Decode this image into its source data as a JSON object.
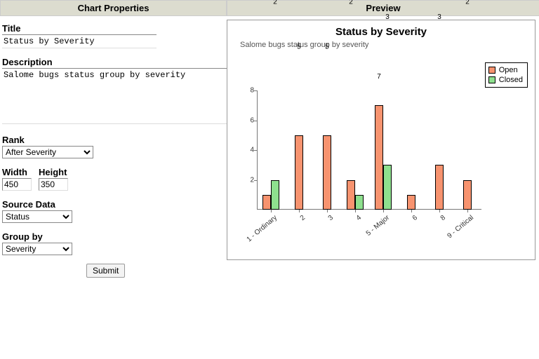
{
  "headers": {
    "properties": "Chart Properties",
    "preview": "Preview"
  },
  "form": {
    "title_label": "Title",
    "title_value": "Status by Severity",
    "description_label": "Description",
    "description_value": "Salome bugs status group by severity",
    "rank_label": "Rank",
    "rank_value": "After Severity",
    "width_label": "Width",
    "width_value": "450",
    "height_label": "Height",
    "height_value": "350",
    "source_data_label": "Source Data",
    "source_data_value": "Status",
    "group_by_label": "Group by",
    "group_by_value": "Severity",
    "submit_label": "Submit"
  },
  "chart_data": {
    "type": "bar",
    "title": "Status by Severity",
    "subtitle": "Salome bugs status group by severity",
    "xlabel": "",
    "ylabel": "",
    "ylim": [
      0,
      8
    ],
    "yticks": [
      2,
      4,
      6,
      8
    ],
    "categories": [
      "1 - Ordinary",
      "2",
      "3",
      "4",
      "5 - Major",
      "6",
      "8",
      "9 - Critical"
    ],
    "series": [
      {
        "name": "Open",
        "color": "#f7936f",
        "values": [
          1,
          5,
          5,
          2,
          7,
          1,
          3,
          2
        ]
      },
      {
        "name": "Closed",
        "color": "#8ee08e",
        "values": [
          2,
          null,
          null,
          1,
          3,
          null,
          null,
          null
        ]
      }
    ],
    "legend_position": "right"
  }
}
